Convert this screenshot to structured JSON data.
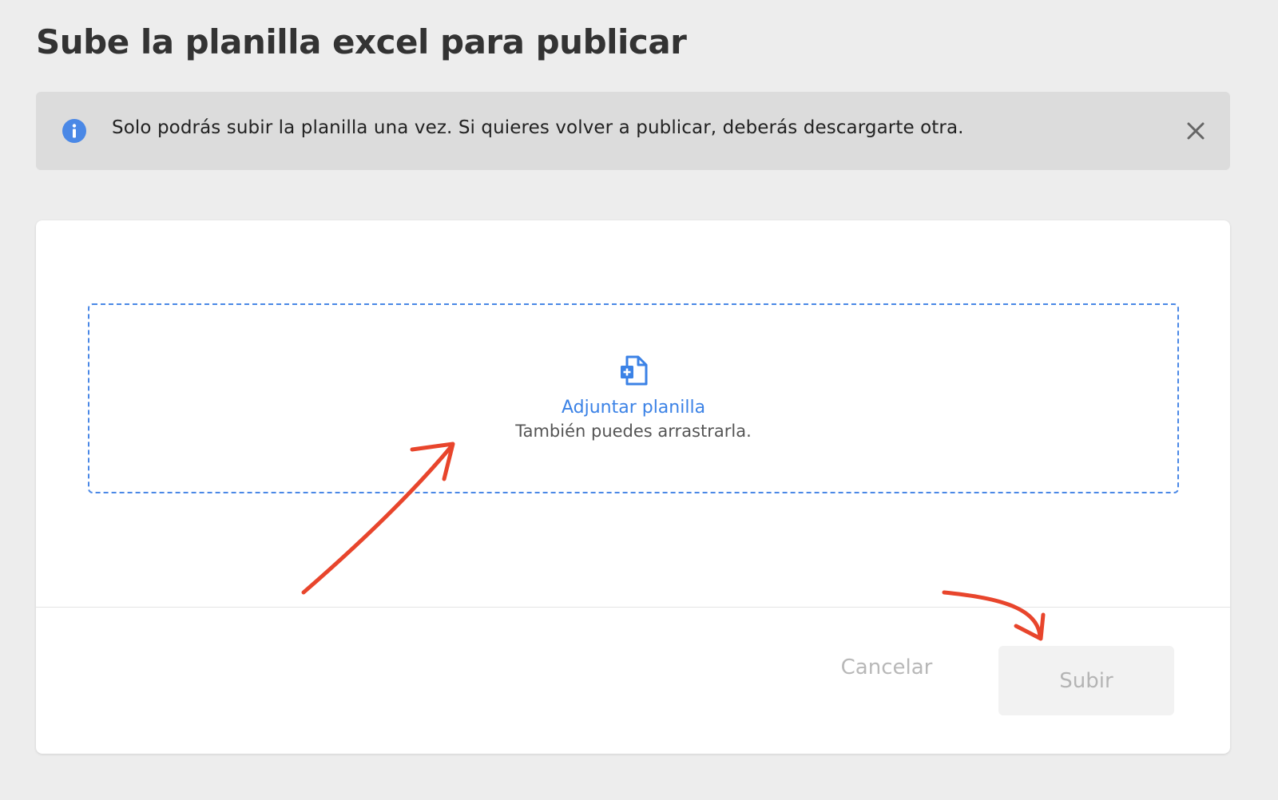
{
  "page": {
    "title": "Sube la planilla excel para publicar"
  },
  "banner": {
    "message": "Solo podrás subir la planilla una vez. Si quieres volver a publicar, deberás descargarte otra.",
    "info_icon": "info-icon",
    "close_icon": "close-icon",
    "info_color": "#4a88e6"
  },
  "dropzone": {
    "attach_label": "Adjuntar planilla",
    "drag_hint": "También puedes arrastrarla.",
    "file_icon": "file-add-icon",
    "accent_color": "#3b82e6"
  },
  "actions": {
    "cancel_label": "Cancelar",
    "submit_label": "Subir"
  },
  "annotations": {
    "arrow_color": "#e8452c"
  }
}
